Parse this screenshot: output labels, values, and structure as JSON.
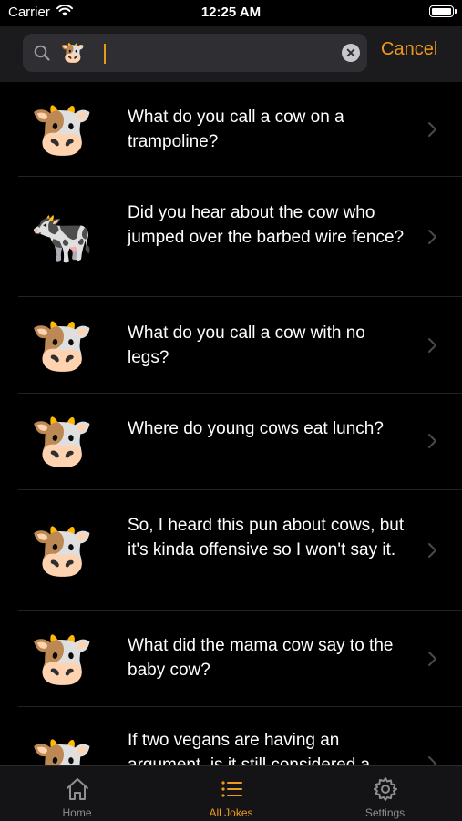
{
  "status_bar": {
    "carrier": "Carrier",
    "time": "12:25 AM"
  },
  "search": {
    "query": "🐮",
    "cancel_label": "Cancel"
  },
  "list": {
    "items": [
      {
        "emoji": "🐮",
        "text": "What do you call a cow on a trampoline?"
      },
      {
        "emoji": "🐄",
        "text": "Did you hear about the cow who jumped over the barbed wire fence?"
      },
      {
        "emoji": "🐮",
        "text": "What do you call a cow with no legs?"
      },
      {
        "emoji": "🐮",
        "text": "Where do young cows eat lunch?"
      },
      {
        "emoji": "🐮",
        "text": "So, I heard this pun about cows, but it's kinda offensive so I won't say it."
      },
      {
        "emoji": "🐮",
        "text": "What did the mama cow say to the baby cow?"
      },
      {
        "emoji": "🐮",
        "text": "If two vegans are having an argument, is it still considered a"
      }
    ]
  },
  "tabbar": {
    "tabs": [
      {
        "label": "Home",
        "icon": "house-icon"
      },
      {
        "label": "All Jokes",
        "icon": "list-icon"
      },
      {
        "label": "Settings",
        "icon": "gear-icon"
      }
    ],
    "active_color": "#f09a1d",
    "inactive_color": "#8e8e93"
  }
}
